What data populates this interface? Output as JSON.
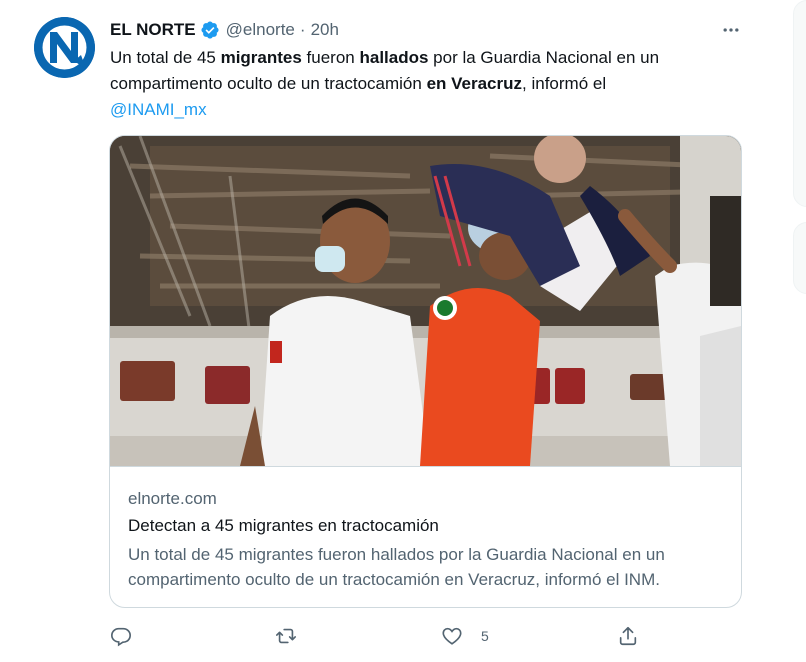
{
  "tweet": {
    "author_name": "EL NORTE",
    "handle": "@elnorte",
    "separator": "·",
    "time": "20h",
    "text_parts": {
      "p1": "Un total de 45 ",
      "b1": "migrantes",
      "p2": " fueron ",
      "b2": "hallados",
      "p3": " por la Guardia Nacional en un compartimento oculto de un tractocamión ",
      "b3": "en Veracruz",
      "p4": ", informó el ",
      "mention": "@INAMI_mx"
    },
    "accent_color": "#1d9bf0"
  },
  "avatar": {
    "letter": "N",
    "bg_color": "#0a67b1"
  },
  "card": {
    "domain": "elnorte.com",
    "title": "Detectan a 45 migrantes en tractocamión",
    "description": "Un total de 45 migrantes fueron hallados por la Guardia Nacional en un compartimento oculto de un tractocamión en Veracruz, informó el INM."
  },
  "actions": {
    "reply_icon": "reply-icon",
    "retweet_icon": "retweet-icon",
    "like_icon": "heart-icon",
    "like_count": "5",
    "share_icon": "share-icon"
  }
}
